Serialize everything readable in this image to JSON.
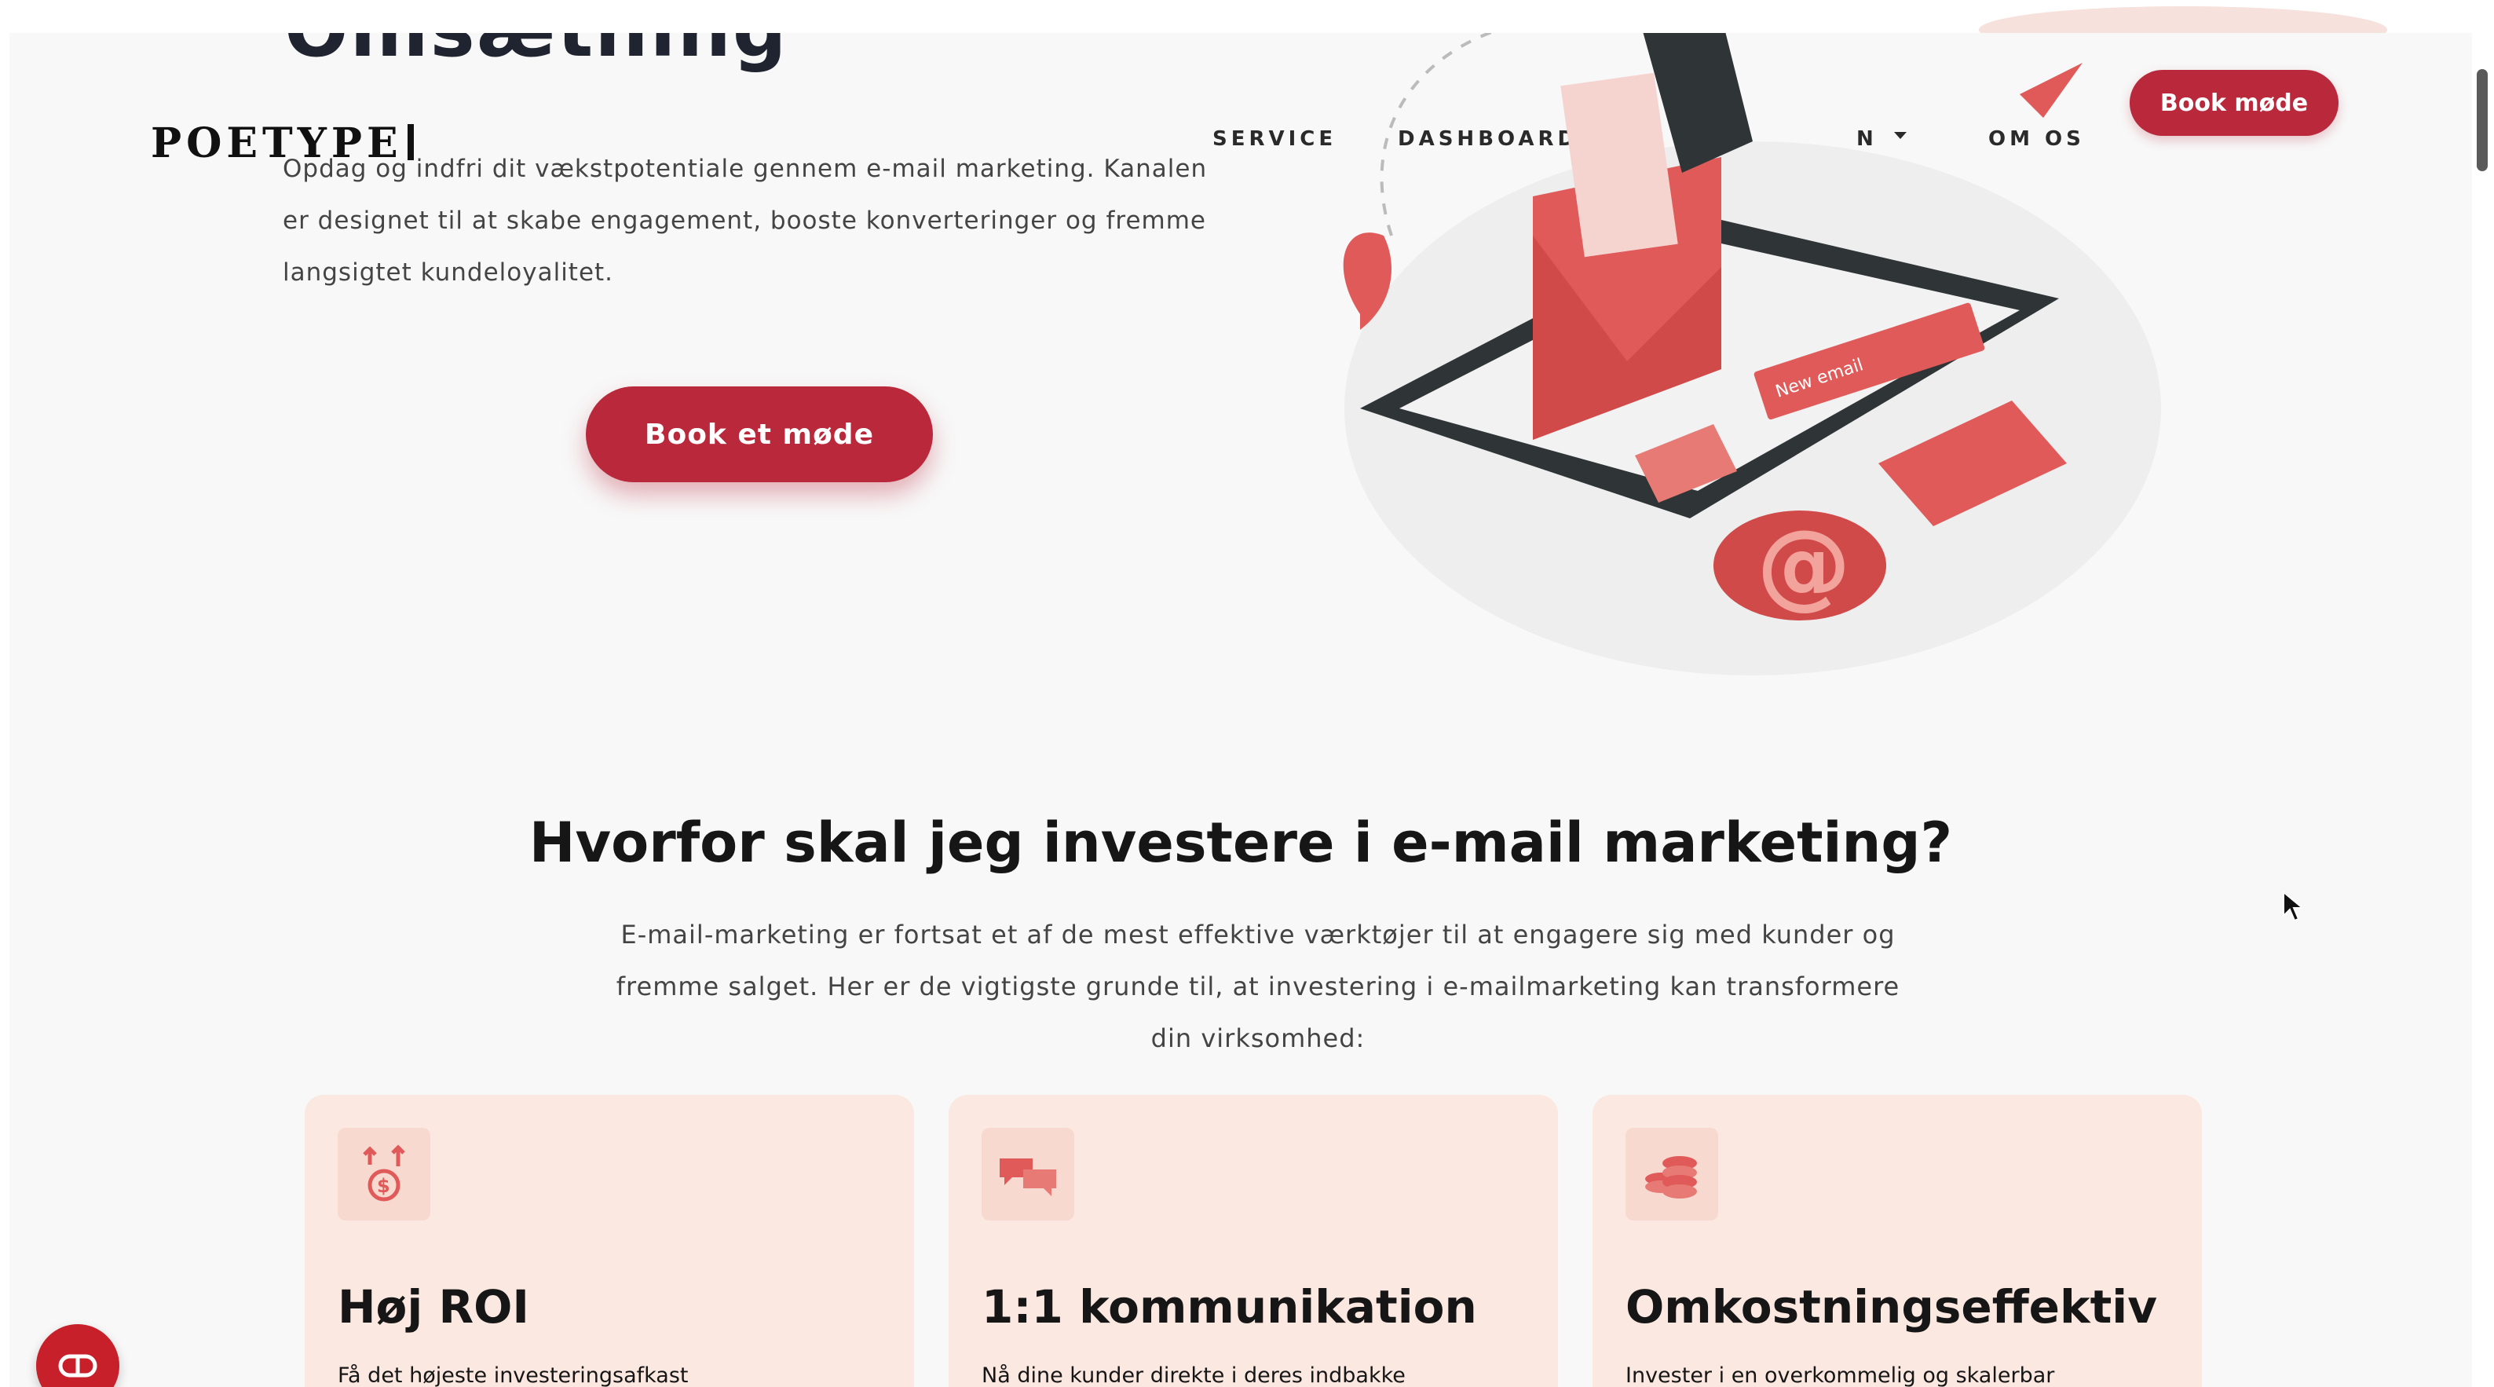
{
  "colors": {
    "brand": "#b9283b",
    "card_bg": "#fbe8e0",
    "page_bg": "#f8f8f8",
    "illustration": "#e05a5a"
  },
  "hero": {
    "title": "Omsætning",
    "text": "Opdag og indfri dit vækstpotentiale gennem e-mail marketing. Kanalen er designet til at skabe engagement, booste konverteringer og fremme langsigtet kundeloyalitet.",
    "cta": "Book et møde",
    "illustration_label": "New email"
  },
  "header": {
    "logo": "POETYPE",
    "nav": [
      "SERVICE",
      "DASHBOARD",
      "OM OS"
    ],
    "nav_fragment": "N",
    "cta": "Book møde"
  },
  "section": {
    "title": "Hvorfor skal jeg investere i e-mail marketing?",
    "text": "E-mail-marketing er fortsat et af de mest effektive værktøjer til at engagere sig med kunder og fremme salget. Her er de vigtigste grunde til, at investering i e-mailmarketing kan transformere din virksomhed:"
  },
  "cards": [
    {
      "icon": "roi-coin-icon",
      "title": "Høj ROI",
      "text": "Få det højeste investeringsafkast"
    },
    {
      "icon": "chat-bubbles-icon",
      "title": "1:1 kommunikation",
      "text": "Nå dine kunder direkte i deres indbakke"
    },
    {
      "icon": "coin-stack-icon",
      "title": "Omkostningseffektiv",
      "text": "Invester i en overkommelig og skalerbar"
    }
  ],
  "widget": {
    "icon": "chat-widget-icon"
  }
}
